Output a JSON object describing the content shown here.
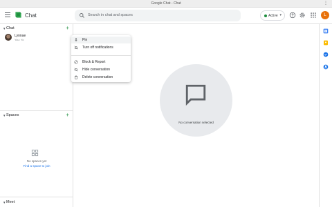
{
  "window": {
    "title": "Google Chat - Chat",
    "menu_glyph": "⋮"
  },
  "header": {
    "app_name": "Chat",
    "search_placeholder": "Search in chat and spaces",
    "status_label": "Active",
    "status_color": "#1e8e3e",
    "avatar_initial": "L",
    "icons": [
      "menu-icon",
      "chat-logo",
      "search-icon",
      "help-icon",
      "settings-icon",
      "apps-grid-icon"
    ]
  },
  "sidebar": {
    "chat_section": {
      "label": "Chat"
    },
    "dms": [
      {
        "name": "Lynnae",
        "subtitle": "You: Yo"
      }
    ],
    "spaces_section": {
      "label": "Spaces",
      "empty_text": "No spaces yet",
      "find_link": "Find a space to join"
    },
    "meet_section": {
      "label": "Meet"
    },
    "accent_color": "#1e8e3e",
    "link_color": "#1a73e8"
  },
  "main": {
    "empty_text": "No conversation selected"
  },
  "context_menu": {
    "items": [
      {
        "label": "Pin",
        "icon": "pin-icon"
      },
      {
        "label": "Turn off notifications",
        "icon": "bell-off-icon"
      },
      {
        "label": "Block & Report",
        "icon": "block-icon"
      },
      {
        "label": "Hide conversation",
        "icon": "hide-icon"
      },
      {
        "label": "Delete conversation",
        "icon": "trash-icon"
      }
    ]
  },
  "right_rail": {
    "icons": [
      "calendar-icon",
      "keep-icon",
      "tasks-icon",
      "contacts-icon"
    ]
  }
}
